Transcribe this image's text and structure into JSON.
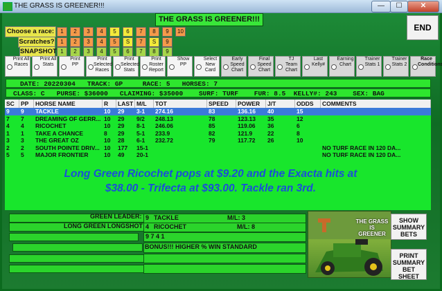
{
  "window": {
    "title": "THE GRASS IS GREENER!!!",
    "minimize": "—",
    "maximize": "☐",
    "close": "✕"
  },
  "banner": "THE GRASS IS GREENER!!!",
  "race_labels": {
    "choose": "Choose a race:",
    "scratches": "Scratches?",
    "snapshot": "SNAPSHOT"
  },
  "race_numbers": [
    "1",
    "2",
    "3",
    "4",
    "5",
    "6",
    "7",
    "8",
    "9",
    "10"
  ],
  "scratch_numbers": [
    "1",
    "2",
    "3",
    "4",
    "5",
    "S",
    "7",
    "S",
    "9"
  ],
  "snapshot_numbers": [
    "1",
    "2",
    "3",
    "4",
    "5",
    "6",
    "7",
    "8",
    "9"
  ],
  "end_button": "END",
  "options": [
    {
      "label": "Print All Races"
    },
    {
      "label": "Print All Stats"
    },
    {
      "label": "Print PP"
    },
    {
      "label": "Print Selected Races"
    },
    {
      "label": "Print Selected Stats"
    },
    {
      "label": "Print Roster Report"
    },
    {
      "label": "Show PP"
    },
    {
      "label": "Select New Card"
    },
    {
      "label": "Early Speed Chart"
    },
    {
      "label": "Final Speed Chart"
    },
    {
      "label": "TJ Team Chart"
    },
    {
      "label": "Last Kelly#"
    },
    {
      "label": "Earning Chart"
    },
    {
      "label": "Trainer Stats 1"
    },
    {
      "label": "Trainer Stats 2"
    },
    {
      "label": "Race Conditions"
    }
  ],
  "race_info": {
    "line1": "DATE: 20220304   TRACK: GP     RACE: 5   HORSES: 7",
    "line2": "CLASS: C   PURSE: $36000   CLAIMING: $35000    SURF: TURF    FUR: 8.5  KELLY#: 243    SEX: BAG"
  },
  "table": {
    "headers": [
      "SC",
      "PP",
      "HORSE NAME",
      "R",
      "LAST",
      "M/L",
      "TOT",
      "SPEED",
      "POWER",
      "J/T",
      "ODDS",
      "COMMENTS"
    ],
    "rows": [
      [
        "9",
        "9",
        "TACKLE",
        "10",
        "29",
        "3-1",
        "274.16",
        "83",
        "136.16",
        "40",
        "15",
        ""
      ],
      [
        "7",
        "7",
        "DREAMING OF GERR...",
        "10",
        "29",
        "9/2",
        "248.13",
        "78",
        "123.13",
        "35",
        "12",
        ""
      ],
      [
        "4",
        "4",
        "RICOCHET",
        "10",
        "29",
        "8-1",
        "246.06",
        "85",
        "119.06",
        "36",
        "6",
        ""
      ],
      [
        "1",
        "1",
        "TAKE A CHANCE",
        "8",
        "29",
        "5-1",
        "233.9",
        "82",
        "121.9",
        "22",
        "8",
        ""
      ],
      [
        "3",
        "3",
        "THE GREAT OZ",
        "10",
        "28",
        "6-1",
        "232.72",
        "79",
        "117.72",
        "26",
        "10",
        ""
      ],
      [
        "2",
        "2",
        "SOUTH POINTE DRIV...",
        "10",
        "177",
        "15-1",
        "",
        "",
        "",
        "",
        "",
        "NO TURF RACE IN 120 DA..."
      ],
      [
        "5",
        "5",
        "MAJOR FRONTIER",
        "10",
        "49",
        "20-1",
        "",
        "",
        "",
        "",
        "",
        "NO TURF RACE IN 120 DA..."
      ]
    ]
  },
  "message": "Long Green Ricochet pops at $9.20 and the Exacta hits at $38.00 - Trifecta at $93.00.  Tackle ran 3rd.",
  "summary": {
    "green_leader_label": "GREEN LEADER:",
    "longshot_label": "LONG GREEN LONGSHOT",
    "leader_pp": "9",
    "leader_name": "TACKLE",
    "leader_ml": "M/L:  3",
    "longshot_pp": "4",
    "longshot_name": "RICOCHET",
    "longshot_ml": "M/L:  8",
    "picks": "9  7  4  1",
    "bonus": "BONUS!!! HIGHER % WIN STANDARD"
  },
  "logo_text": "THE GRASS IS GREENER",
  "buttons": {
    "show_summary": "SHOW SUMMARY BETS",
    "print_summary": "PRINT SUMMARY BET SHEET"
  }
}
